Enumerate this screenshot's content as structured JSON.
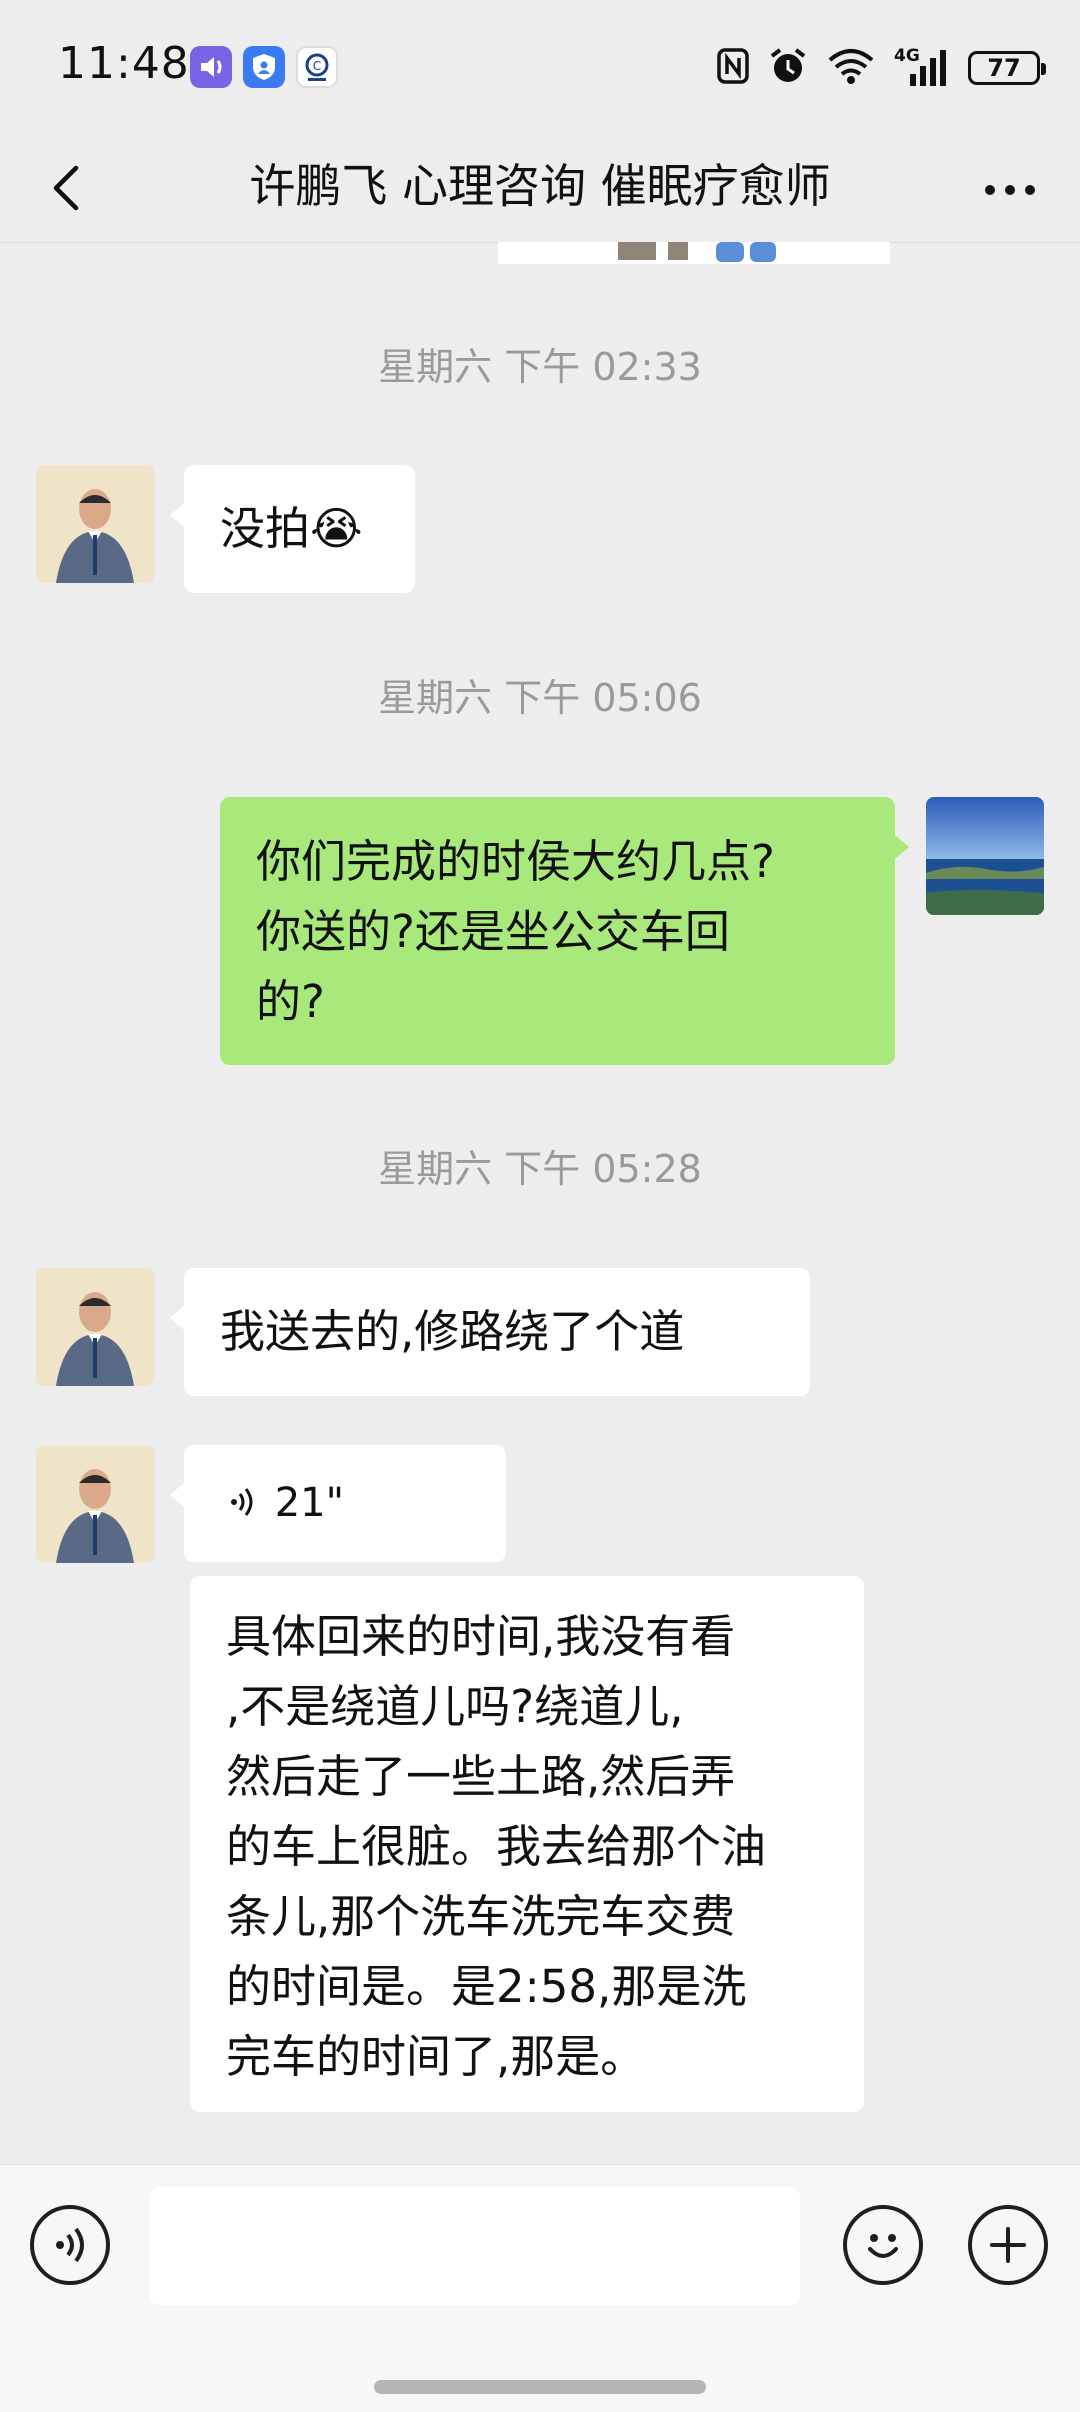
{
  "status_bar": {
    "time": "11:48",
    "network_label": "4G",
    "battery": "77",
    "icons": [
      "volume-app-icon",
      "shield-app-icon",
      "clean-app-icon",
      "nfc-icon",
      "alarm-icon",
      "wifi-icon",
      "signal-icon",
      "battery-icon"
    ]
  },
  "header": {
    "title": "许鹏飞 心理咨询 催眠疗愈师",
    "back_icon": "chevron-left-icon",
    "more_icon": "more-dots-icon"
  },
  "timestamps": [
    "星期六 下午 02:33",
    "星期六 下午 05:06",
    "星期六 下午 05:28"
  ],
  "messages": [
    {
      "from": "contact",
      "text": "没拍",
      "emoji": "😭"
    },
    {
      "from": "me",
      "text_lines": [
        "你们完成的时侯大约几点?",
        "你送的?还是坐公交车回",
        "的?"
      ]
    },
    {
      "from": "contact",
      "text": "我送去的,修路绕了个道"
    },
    {
      "from": "contact",
      "type": "voice",
      "duration": "21\""
    },
    {
      "from": "contact",
      "type": "transcript",
      "text_lines": [
        "具体回来的时间,我没有看",
        ",不是绕道儿吗?绕道儿,",
        "然后走了一些土路,然后弄",
        "的车上很脏。我去给那个油",
        "条儿,那个洗车洗完车交费",
        "的时间是。是2:58,那是洗",
        "完车的时间了,那是。"
      ]
    }
  ],
  "input_bar": {
    "voice_icon": "voice-input-icon",
    "emoji_icon": "emoji-icon",
    "plus_icon": "plus-icon"
  },
  "colors": {
    "background": "#ededed",
    "outgoing_bubble": "#a9e97b",
    "incoming_bubble": "#ffffff",
    "timestamp_text": "#9a9a9a"
  }
}
